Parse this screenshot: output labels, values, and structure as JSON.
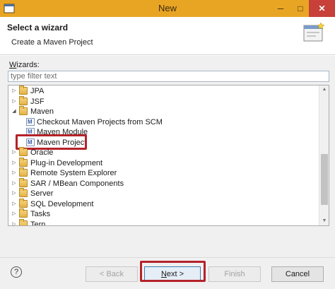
{
  "window": {
    "title": "New",
    "minimize": "─",
    "maximize": "□",
    "close": "✕"
  },
  "header": {
    "title": "Select a wizard",
    "description": "Create a Maven Project",
    "icon": "new-wizard-icon"
  },
  "wizards_label": {
    "mnemonic": "W",
    "rest": "izards:"
  },
  "filter": {
    "placeholder": "type filter text",
    "value": ""
  },
  "tree": {
    "items": [
      {
        "label": "JPA",
        "type": "folder",
        "expanded": false,
        "level": 0
      },
      {
        "label": "JSF",
        "type": "folder",
        "expanded": false,
        "level": 0
      },
      {
        "label": "Maven",
        "type": "folder",
        "expanded": true,
        "level": 0
      },
      {
        "label": "Checkout Maven Projects from SCM",
        "type": "maven",
        "level": 1
      },
      {
        "label": "Maven Module",
        "type": "maven",
        "level": 1
      },
      {
        "label": "Maven Project",
        "type": "maven",
        "level": 1,
        "highlighted": true
      },
      {
        "label": "Oracle",
        "type": "folder",
        "expanded": false,
        "level": 0
      },
      {
        "label": "Plug-in Development",
        "type": "folder",
        "expanded": false,
        "level": 0
      },
      {
        "label": "Remote System Explorer",
        "type": "folder",
        "expanded": false,
        "level": 0
      },
      {
        "label": "SAR / MBean Components",
        "type": "folder",
        "expanded": false,
        "level": 0
      },
      {
        "label": "Server",
        "type": "folder",
        "expanded": false,
        "level": 0
      },
      {
        "label": "SQL Development",
        "type": "folder",
        "expanded": false,
        "level": 0
      },
      {
        "label": "Tasks",
        "type": "folder",
        "expanded": false,
        "level": 0
      },
      {
        "label": "Tern",
        "type": "folder",
        "expanded": false,
        "level": 0
      }
    ]
  },
  "footer": {
    "help": "?",
    "back": "< Back",
    "next": "Next >",
    "finish": "Finish",
    "cancel": "Cancel"
  },
  "colors": {
    "titlebar": "#e8a524",
    "highlight": "#b5222a",
    "close": "#c7403a"
  }
}
